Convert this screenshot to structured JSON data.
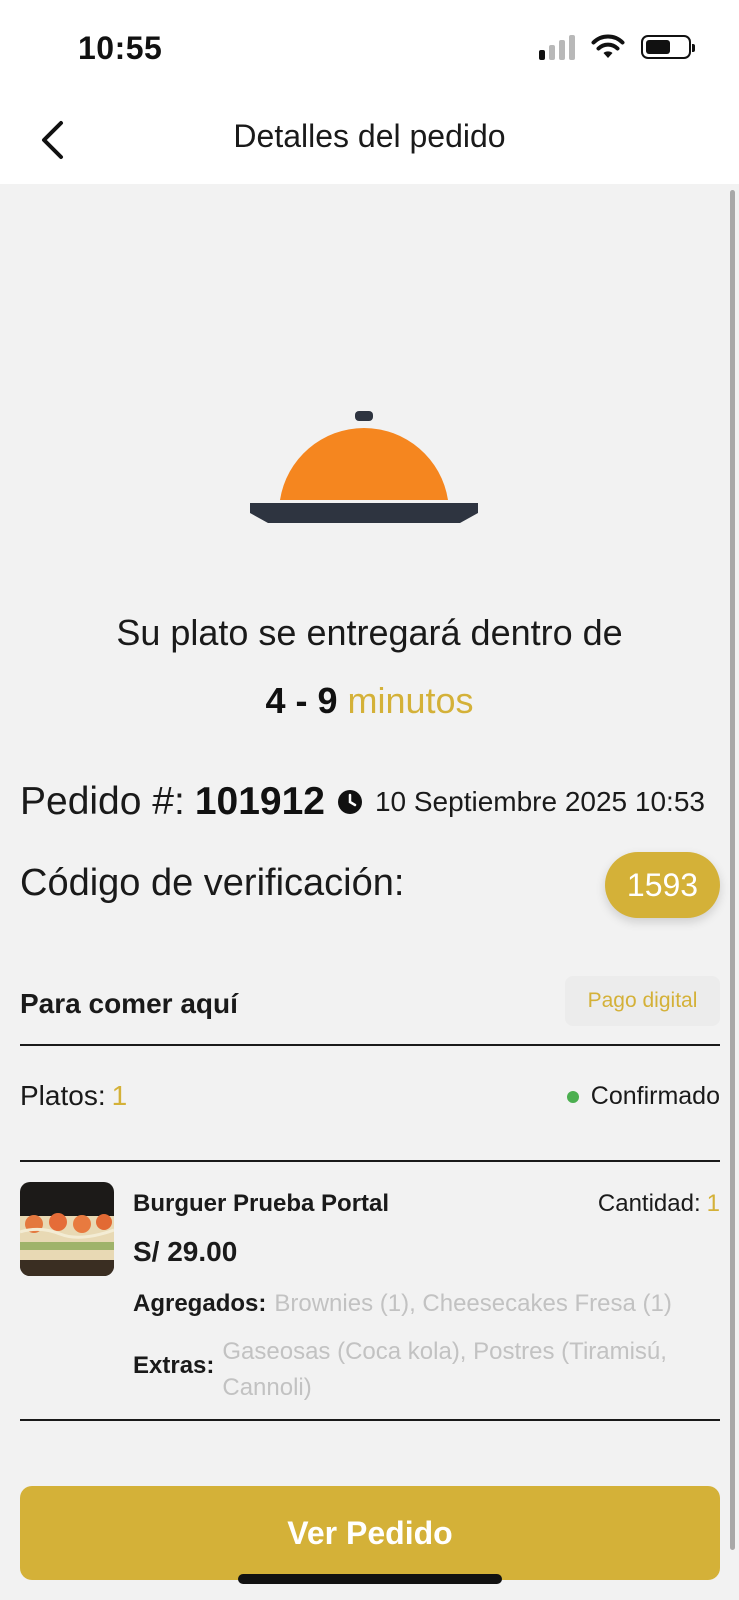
{
  "status_bar": {
    "time": "10:55"
  },
  "header": {
    "title": "Detalles del pedido"
  },
  "delivery": {
    "message": "Su plato se entregará dentro de",
    "range": "4 - 9",
    "unit": "minutos"
  },
  "order": {
    "label": "Pedido #:",
    "number": "101912",
    "datetime": "10 Septiembre 2025 10:53"
  },
  "verification": {
    "label": "Código de verificación:",
    "code": "1593"
  },
  "service": {
    "type": "Para comer aquí",
    "payment": "Pago digital"
  },
  "plates": {
    "label": "Platos:",
    "count": "1",
    "status": "Confirmado"
  },
  "item": {
    "name": "Burguer Prueba Portal",
    "quantity_label": "Cantidad:",
    "quantity": "1",
    "price": "S/ 29.00",
    "addons_label": "Agregados:",
    "addons": "Brownies (1),  Cheesecakes Fresa (1)",
    "extras_label": "Extras:",
    "extras": "Gaseosas (Coca kola), Postres (Tiramisú, Cannoli)"
  },
  "cta": {
    "label": "Ver Pedido"
  },
  "colors": {
    "accent": "#d4b138",
    "cloche": "#f5861f",
    "tray": "#2e3440",
    "confirmed": "#4caf50",
    "muted": "#c2c2c2"
  }
}
